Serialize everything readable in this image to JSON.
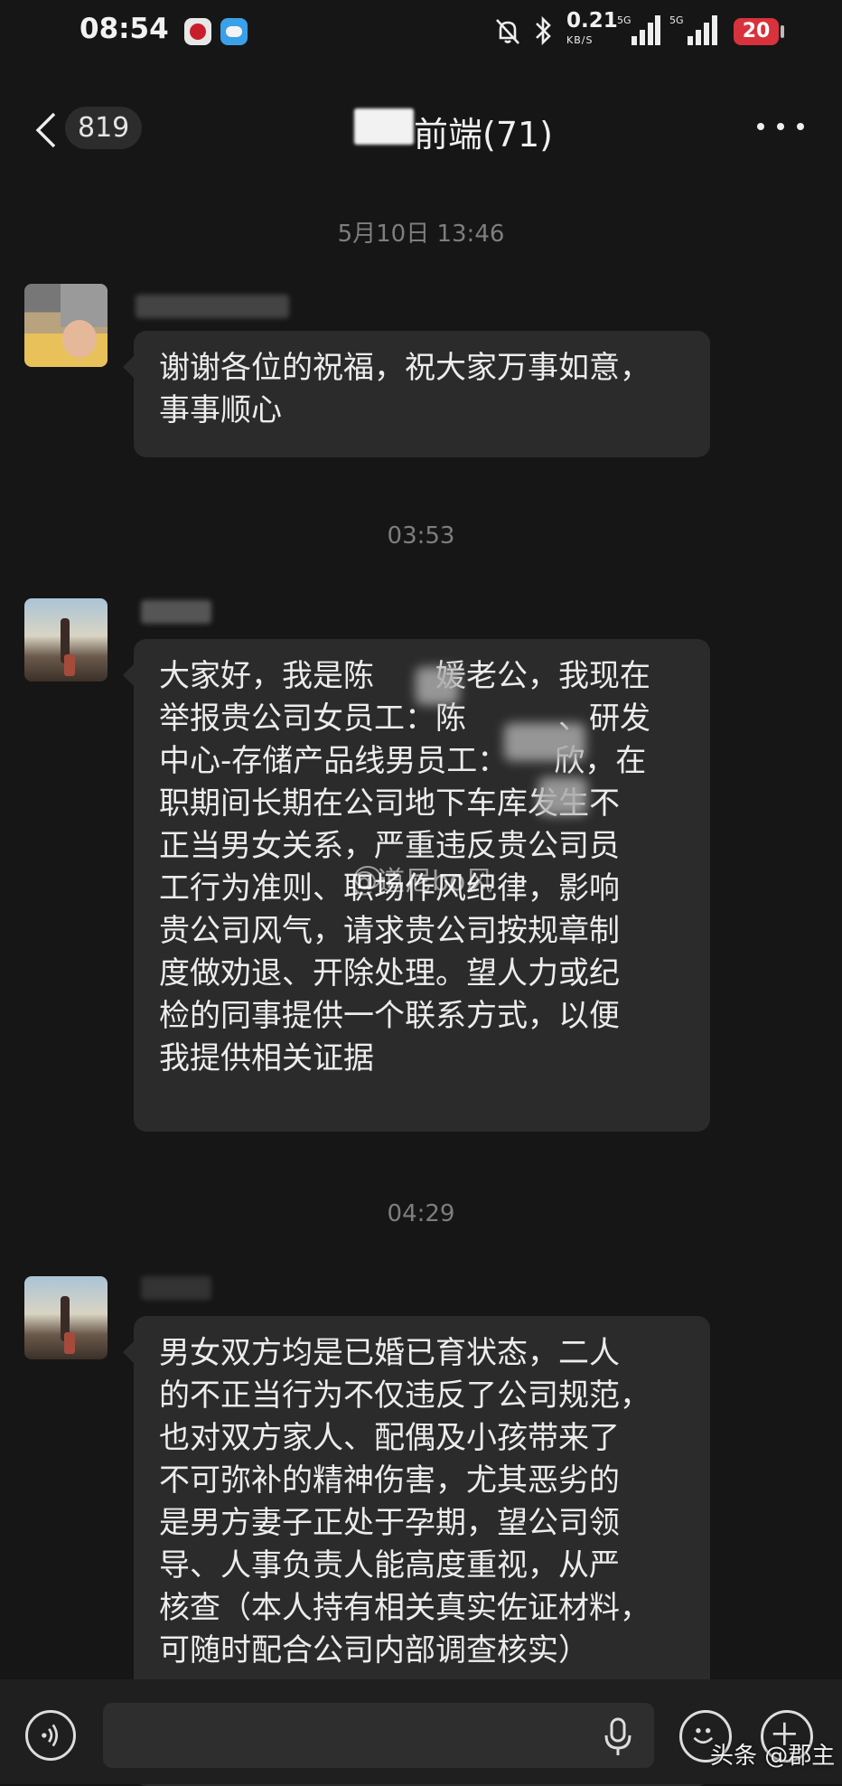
{
  "status_bar": {
    "time": "08:54",
    "net_speed": "0.21",
    "net_unit": "KB/S",
    "signal1_label": "5G",
    "signal2_label": "5G",
    "battery": "20"
  },
  "nav": {
    "back_count": "819",
    "title": "前端(71)"
  },
  "messages": [
    {
      "timestamp": "5月10日 13:46",
      "text": "谢谢各位的祝福，祝大家万事如意，\n事事顺心"
    },
    {
      "timestamp": "03:53",
      "text": "大家好，我是陈　　媛老公，我现在\n举报贵公司女员工：陈　　　、研发\n中心-存储产品线男员工：　　欣，在\n职期间长期在公司地下车库发生不\n正当男女关系，严重违反贵公司员\n工行为准则、职场作风纪律，影响\n贵公司风气，请求贵公司按规章制\n度做劝退、开除处理。望人力或纪\n检的同事提供一个联系方式，以便\n我提供相关证据"
    },
    {
      "timestamp": "04:29",
      "text": "男女双方均是已婚已育状态，二人\n的不正当行为不仅违反了公司规范，\n也对双方家人、配偶及小孩带来了\n不可弥补的精神伤害，尤其恶劣的\n是男方妻子正处于孕期，望公司领\n导、人事负责人能高度重视，从严\n核查（本人持有相关真实佐证材料，\n可随时配合公司内部调查核实）"
    }
  ],
  "watermark": "@道尼bo风",
  "brand_watermark": "头条 @郡主",
  "icons": {
    "back": "chevron-left-icon",
    "more": "more-dots-icon",
    "voice": "voice-icon",
    "mic": "mic-icon",
    "emoji": "emoji-icon",
    "plus": "plus-icon"
  }
}
